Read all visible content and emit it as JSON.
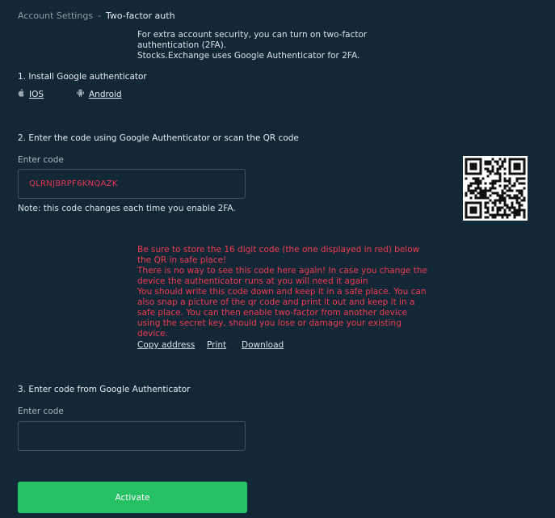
{
  "breadcrumb": {
    "parent": "Account Settings",
    "separator": "-",
    "current": "Two-factor auth"
  },
  "intro": {
    "line1": "For extra account security, you can turn on two-factor authentication (2FA).",
    "line2": "Stocks.Exchange uses Google Authenticator for 2FA."
  },
  "step1": {
    "title": "1. Install Google authenticator",
    "ios_label": "IOS",
    "android_label": "Android",
    "ios_icon": "apple-icon",
    "android_icon": "android-icon"
  },
  "step2": {
    "title": "2. Enter the code using Google Authenticator or scan the QR code",
    "field_label": "Enter code",
    "code_value": "QLRNJBRPF6KNQAZK",
    "note": "Note: this code changes each time you enable 2FA."
  },
  "warning": {
    "p1": "Be sure to store the 16 digit code (the one displayed in red) below the QR in safe place!",
    "p2": "There is no way to see this code here again! In case you change the device the authenticator runs at you will need it again",
    "p3": "You should write this code down and keep it in a safe place. You can also snap a picture of the qr code and print it out and keep it in a safe place. You can then enable two-factor from another device using the secret key, should you lose or damage your existing device."
  },
  "actions": {
    "copy_label": "Copy address",
    "print_label": "Print",
    "download_label": "Download"
  },
  "step3": {
    "title": "3. Enter code from Google Authenticator",
    "field_label": "Enter code",
    "field_value": "",
    "field_placeholder": ""
  },
  "activate_label": "Activate",
  "colors": {
    "background": "#132836",
    "accent_green": "#27c065",
    "warning_red": "#ee3a52",
    "code_red": "#e8344e"
  }
}
